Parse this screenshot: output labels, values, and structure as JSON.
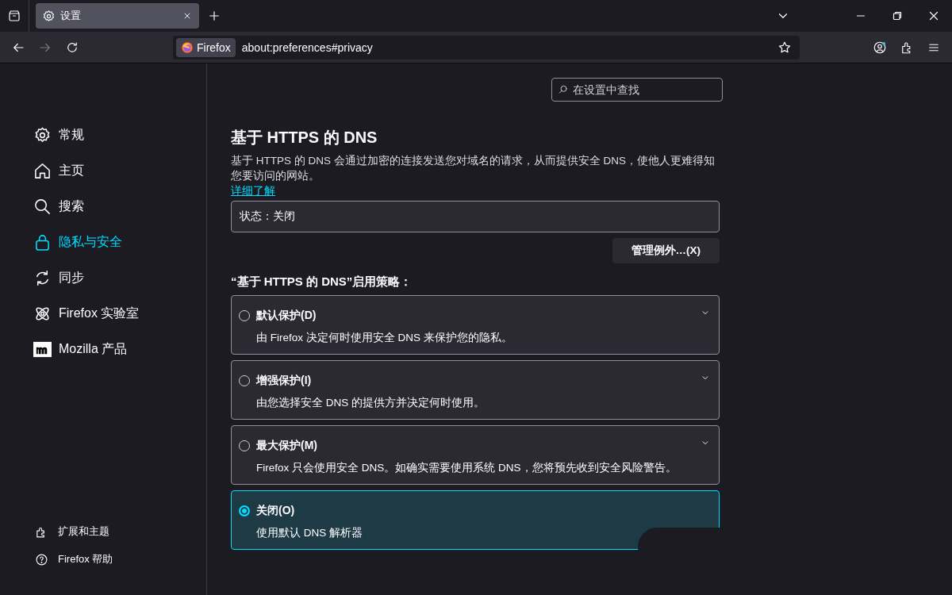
{
  "tabs": [
    {
      "title": "设置",
      "selected": true
    }
  ],
  "toolbar": {
    "identity_label": "Firefox",
    "url": "about:preferences#privacy"
  },
  "search": {
    "placeholder": "在设置中查找"
  },
  "sidebar": {
    "items": [
      {
        "label": "常规",
        "selected": false
      },
      {
        "label": "主页",
        "selected": false
      },
      {
        "label": "搜索",
        "selected": false
      },
      {
        "label": "隐私与安全",
        "selected": true
      },
      {
        "label": "同步",
        "selected": false
      },
      {
        "label": "Firefox 实验室",
        "selected": false
      },
      {
        "label": "Mozilla 产品",
        "selected": false
      }
    ],
    "footer": [
      {
        "label": "扩展和主题"
      },
      {
        "label": "Firefox 帮助"
      }
    ]
  },
  "section": {
    "title": "基于 HTTPS 的 DNS",
    "description": "基于 HTTPS 的 DNS 会通过加密的连接发送您对域名的请求，从而提供安全 DNS，使他人更难得知您要访问的网站。",
    "link": "详细了解",
    "status": "状态：关闭",
    "manage_button": "管理例外…(X)",
    "policy_heading": "“基于 HTTPS 的 DNS”启用策略：",
    "options": [
      {
        "label": "默认保护(D)",
        "description": "由 Firefox 决定何时使用安全 DNS 来保护您的隐私。",
        "selected": false,
        "expandable": true
      },
      {
        "label": "增强保护(I)",
        "description": "由您选择安全 DNS 的提供方并决定何时使用。",
        "selected": false,
        "expandable": true
      },
      {
        "label": "最大保护(M)",
        "description": "Firefox 只会使用安全 DNS。如确实需要使用系统 DNS，您将预先收到安全风险警告。",
        "selected": false,
        "expandable": true
      },
      {
        "label": "关闭(O)",
        "description": "使用默认 DNS 解析器",
        "selected": true,
        "expandable": false
      }
    ]
  }
}
